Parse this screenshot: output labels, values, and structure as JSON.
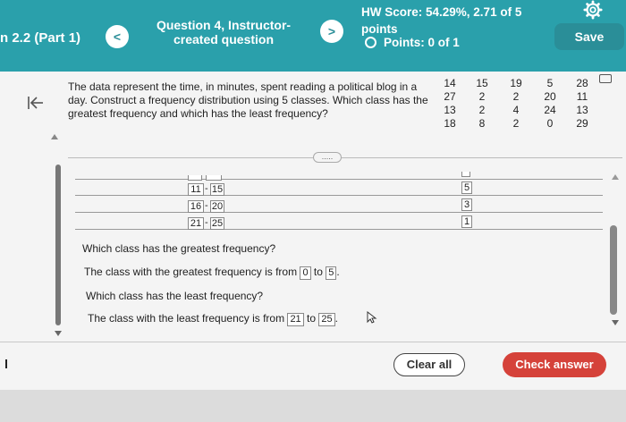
{
  "header": {
    "section_title": "n 2.2 (Part 1)",
    "prev_label": "<",
    "next_label": ">",
    "question_title": "Question 4, Instructor-created question",
    "hw_score": "HW Score: 54.29%, 2.71 of 5",
    "hw_score_cont": "points",
    "points": "Points: 0 of 1",
    "save_label": "Save",
    "settings_icon": "gear-icon",
    "accent_color": "#2aa0ab"
  },
  "problem": {
    "back_icon": "back-to-first-icon",
    "text": "The data represent the time, in minutes, spent reading a political blog in a day. Construct a frequency distribution using 5 classes. Which class has the greatest frequency and which has the least frequency?",
    "data_columns": [
      [
        "14",
        "27",
        "13",
        "18"
      ],
      [
        "15",
        "2",
        "2",
        "8"
      ],
      [
        "19",
        "2",
        "4",
        "2"
      ],
      [
        "5",
        "20",
        "24",
        "0"
      ],
      [
        "28",
        "11",
        "13",
        "29"
      ]
    ],
    "more_label": "....."
  },
  "table": {
    "rows": [
      {
        "lower": "11",
        "upper": "15",
        "freq": "5"
      },
      {
        "lower": "16",
        "upper": "20",
        "freq": "3"
      },
      {
        "lower": "21",
        "upper": "25",
        "freq": "1"
      }
    ],
    "dash": "-"
  },
  "questions": {
    "greatest_q": "Which class has the greatest frequency?",
    "greatest_prefix": "The class with the greatest frequency is from",
    "greatest_from": "0",
    "to_word": "to",
    "greatest_to": "5",
    "least_q": "Which class has the least frequency?",
    "least_prefix": "The class with the least frequency is from",
    "least_from": "21",
    "least_to": "25",
    "period": "."
  },
  "footer": {
    "clear_label": "Clear all",
    "check_label": "Check answer",
    "check_color": "#d5423a"
  }
}
